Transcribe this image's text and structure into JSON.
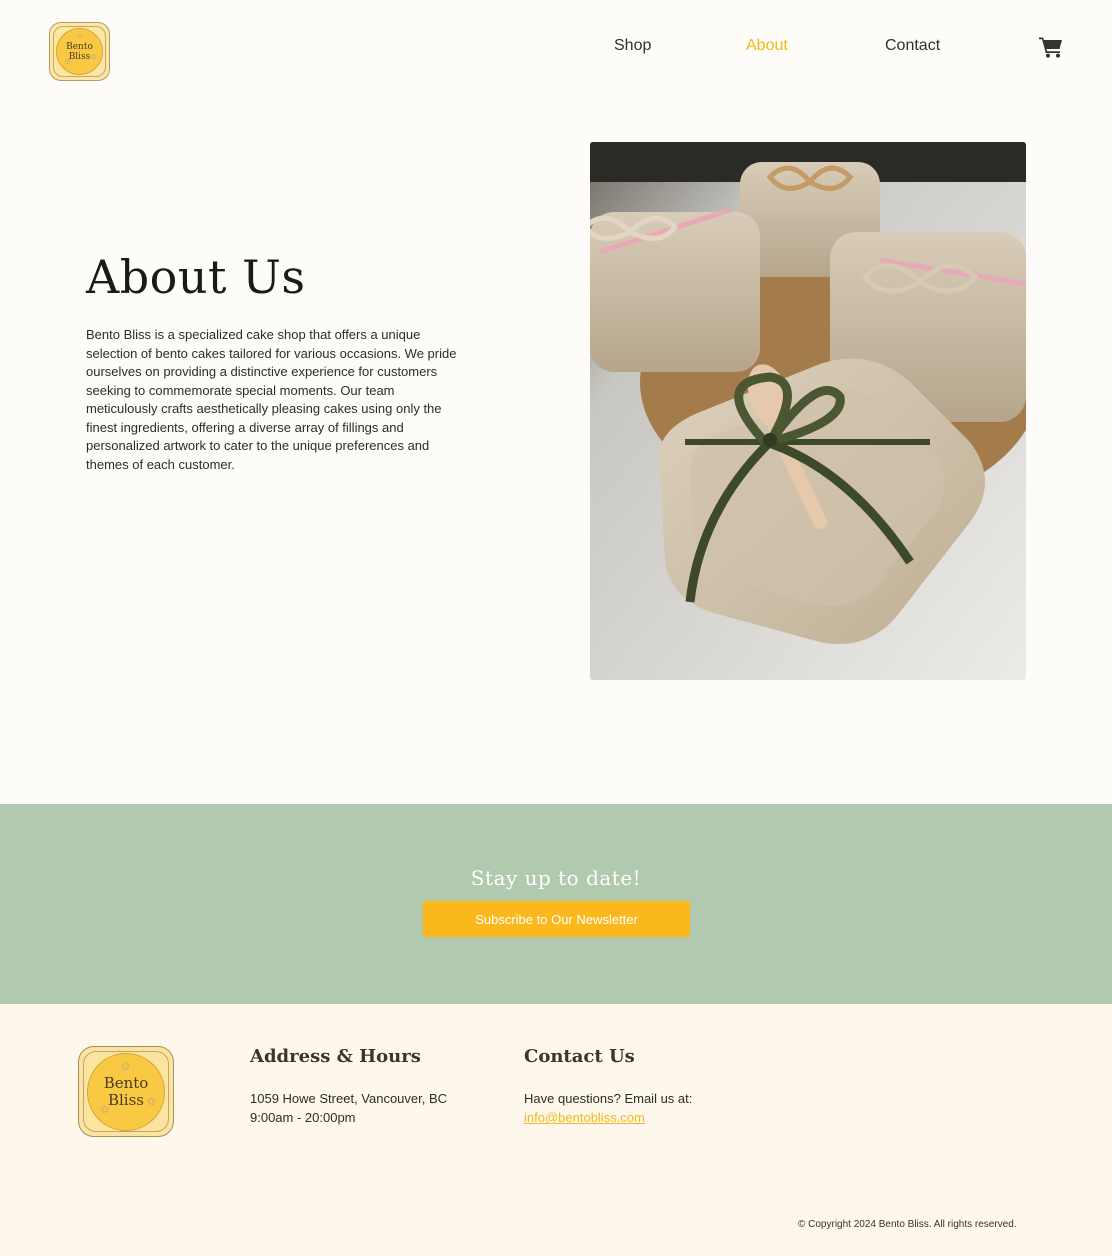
{
  "brand": {
    "logo_line1": "Bento",
    "logo_line2": "Bliss",
    "accent_color": "#fbb81c",
    "green_color": "#b1c9ae"
  },
  "nav": {
    "items": [
      {
        "label": "Shop",
        "active": false
      },
      {
        "label": "About",
        "active": true
      },
      {
        "label": "Contact",
        "active": false
      }
    ],
    "cart_icon": "cart-icon"
  },
  "about": {
    "title": "About Us",
    "body": "Bento Bliss is a specialized cake shop that offers a unique selection of bento cakes tailored for various occasions. We pride ourselves on providing a distinctive experience for customers seeking to commemorate special moments. Our team meticulously crafts aesthetically pleasing cakes using only the finest ingredients, offering a diverse array of fillings and personalized artwork to cater to the unique preferences and themes of each customer."
  },
  "newsletter": {
    "title": "Stay up to date!",
    "button_label": "Subscribe to Our Newsletter"
  },
  "footer": {
    "address_heading": "Address & Hours",
    "address": "1059 Howe Street, Vancouver, BC",
    "hours": "9:00am - 20:00pm",
    "contact_heading": "Contact Us",
    "contact_text": "Have questions? Email us at:",
    "email": "info@bentobliss.com",
    "copyright": "© Copyright 2024 Bento Bliss. All rights reserved."
  }
}
